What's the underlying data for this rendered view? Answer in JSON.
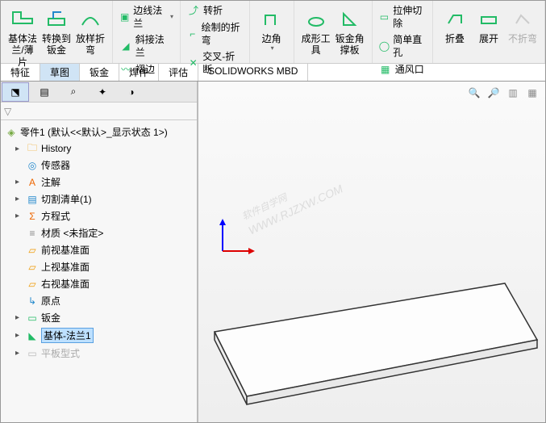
{
  "ribbon": {
    "baseFlange": "基体法兰/薄片",
    "convertSheet": "转换到钣金",
    "loftedBend": "放样折弯",
    "edgeFlange": "边线法兰",
    "miterFlange": "斜接法兰",
    "hem": "褶边",
    "jog": "转折",
    "sketchedBend": "绘制的折弯",
    "crossBreak": "交叉-折断",
    "corner": "边角",
    "formingTool": "成形工具",
    "cornersTrim": "钣金角撑板",
    "extrudedCut": "拉伸切除",
    "simpleHole": "简单直孔",
    "vent": "通风口",
    "fold": "折叠",
    "unfold": "展开",
    "noBends": "不折弯"
  },
  "tabs": [
    "特征",
    "草图",
    "钣金",
    "焊件",
    "评估",
    "SOLIDWORKS MBD"
  ],
  "activeTab": 1,
  "treeTitle": "零件1  (默认<<默认>_显示状态 1>)",
  "tree": {
    "history": "History",
    "sensors": "传感器",
    "annotations": "注解",
    "cutList": "切割清单(1)",
    "equations": "方程式",
    "material": "材质 <未指定>",
    "frontPlane": "前视基准面",
    "topPlane": "上视基准面",
    "rightPlane": "右视基准面",
    "origin": "原点",
    "sheetMetal": "钣金",
    "baseFlange1": "基体-法兰1",
    "flatPattern": "平板型式"
  },
  "watermark": {
    "line1": "软件自学网",
    "line2": "WWW.RJZXW.COM"
  }
}
